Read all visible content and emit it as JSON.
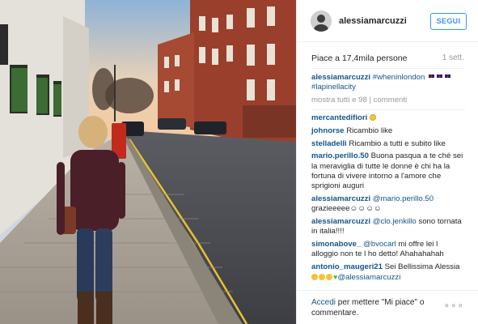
{
  "post": {
    "username": "alessiamarcuzzi",
    "follow_label": "SEGUI",
    "likes": "Piace a 17,4mila persone",
    "time": "1 sett.",
    "caption": {
      "user": "alessiamarcuzzi",
      "text": "#wheninlondon",
      "text2": "#lapinellacity"
    },
    "show_all": "mostra tutti e 98 | commenti",
    "comments": [
      {
        "user": "mercantedifiori",
        "text": ""
      },
      {
        "user": "johnorse",
        "text": "Ricambio like"
      },
      {
        "user": "stelladelli",
        "text": "Ricambio a tutti e subito like"
      },
      {
        "user": "mario.perillo.50",
        "text": "Buona pasqua a te ché sei la meraviglia di tutte le donne è chi ha la fortuna di vivere intorno a l'amore che sprigioni auguri"
      },
      {
        "user": "alessiamarcuzzi",
        "mention": "@mario.perillo.50",
        "text": "grazieeeee☺☺☺☺"
      },
      {
        "user": "alessiamarcuzzi",
        "mention": "@clo.jenkillo",
        "text": "sono tornata in italia!!!!"
      },
      {
        "user": "simonabove_",
        "mention": "@bvocarl",
        "text": "mi offre lei l alloggio non te l ho detto! Ahahahahah"
      },
      {
        "user": "antonio_maugeri21",
        "text": "Sei Bellissima Alessia",
        "mention2": "@alessiamarcuzzi"
      }
    ],
    "footer": {
      "link": "Accedi",
      "text": "per mettere \"Mi piace\" o commentare.",
      "more": "∘∘∘"
    }
  },
  "icons": {
    "avatar": "user-avatar",
    "more": "more-options-icon",
    "flag": "uk-flag-emoji"
  },
  "colors": {
    "link": "#125688",
    "follow": "#3897f0",
    "muted": "#999999"
  }
}
